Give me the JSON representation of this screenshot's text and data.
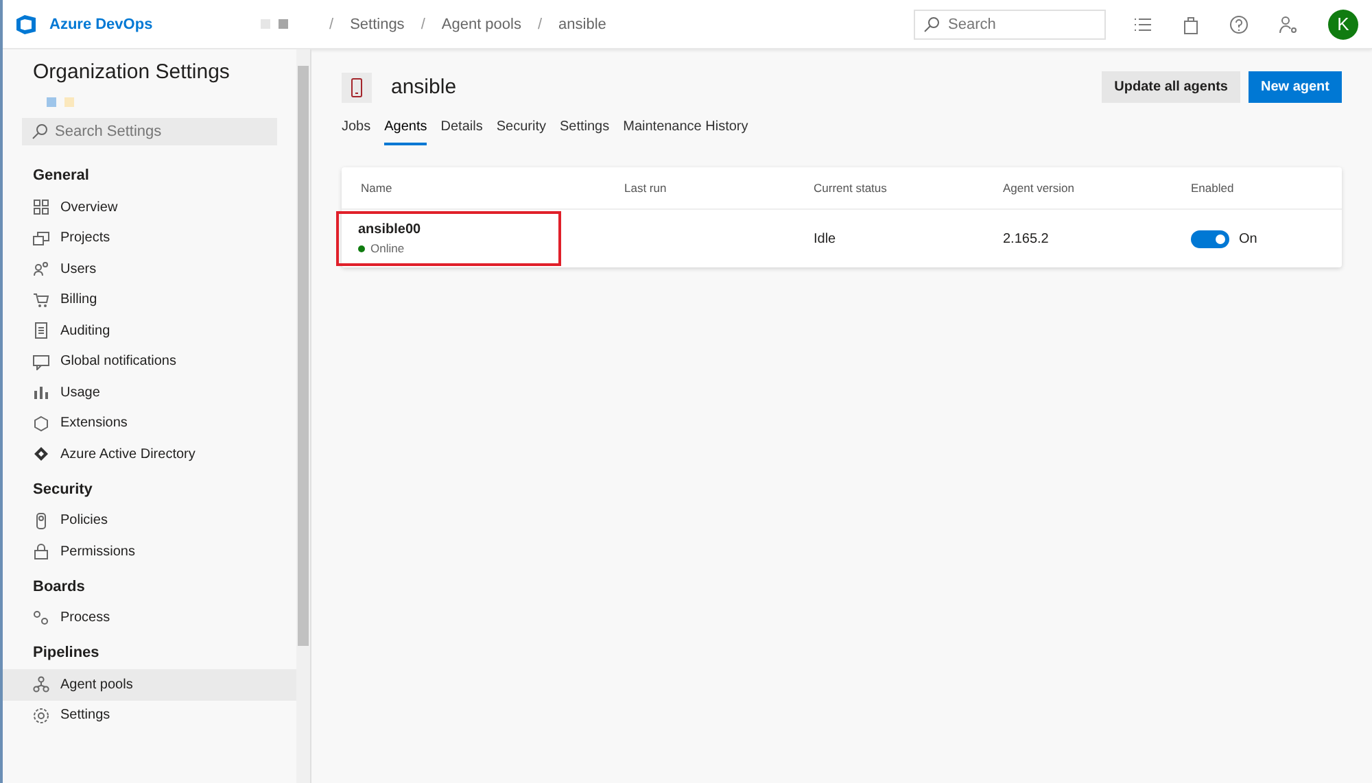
{
  "header": {
    "brand": "Azure DevOps",
    "breadcrumbs": [
      "Settings",
      "Agent pools",
      "ansible"
    ],
    "breadcrumb_separator": "/",
    "search": {
      "placeholder": "Search"
    },
    "avatar": "K"
  },
  "sidebar": {
    "title": "Organization Settings",
    "search": {
      "placeholder": "Search Settings"
    },
    "sections": [
      {
        "heading": "General",
        "items": [
          {
            "label": "Overview",
            "selected": false
          },
          {
            "label": "Projects",
            "selected": false
          },
          {
            "label": "Users",
            "selected": false
          },
          {
            "label": "Billing",
            "selected": false
          },
          {
            "label": "Auditing",
            "selected": false
          },
          {
            "label": "Global notifications",
            "selected": false
          },
          {
            "label": "Usage",
            "selected": false
          },
          {
            "label": "Extensions",
            "selected": false
          },
          {
            "label": "Azure Active Directory",
            "selected": false
          }
        ]
      },
      {
        "heading": "Security",
        "items": [
          {
            "label": "Policies",
            "selected": false
          },
          {
            "label": "Permissions",
            "selected": false
          }
        ]
      },
      {
        "heading": "Boards",
        "items": [
          {
            "label": "Process",
            "selected": false
          }
        ]
      },
      {
        "heading": "Pipelines",
        "items": [
          {
            "label": "Agent pools",
            "selected": true
          },
          {
            "label": "Settings",
            "selected": false
          }
        ]
      }
    ]
  },
  "page": {
    "title": "ansible",
    "buttons": [
      {
        "label": "Update all agents",
        "kind": "secondary"
      },
      {
        "label": "New agent",
        "kind": "primary"
      }
    ],
    "tabs": [
      {
        "label": "Jobs",
        "selected": false
      },
      {
        "label": "Agents",
        "selected": true
      },
      {
        "label": "Details",
        "selected": false
      },
      {
        "label": "Security",
        "selected": false
      },
      {
        "label": "Settings",
        "selected": false
      },
      {
        "label": "Maintenance History",
        "selected": false
      }
    ],
    "table": {
      "columns": [
        "Name",
        "Last run",
        "Current status",
        "Agent version",
        "Enabled"
      ],
      "rows": [
        {
          "name": "ansible00",
          "status": "Online",
          "color": "#107c10",
          "highlighted": true,
          "current_status": "Idle",
          "version": "2.165.2",
          "enabled": true,
          "enabled_label": "On"
        }
      ]
    }
  }
}
